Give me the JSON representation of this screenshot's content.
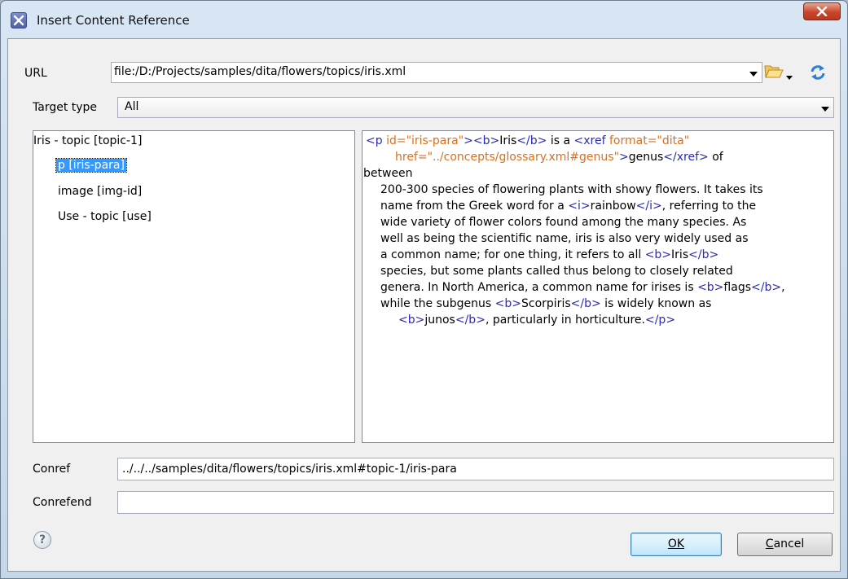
{
  "window": {
    "title": "Insert Content Reference"
  },
  "url": {
    "label": "URL",
    "value": "file:/D:/Projects/samples/dita/flowers/topics/iris.xml"
  },
  "target_type": {
    "label": "Target type",
    "value": "All"
  },
  "tree": {
    "items": [
      {
        "label": "Iris - topic [topic-1]"
      },
      {
        "label": "p [iris-para]"
      },
      {
        "label": "image [img-id]"
      },
      {
        "label": "Use - topic [use]"
      }
    ]
  },
  "preview": {
    "line1": {
      "t1": "<p ",
      "a1": "id=\"iris-para\"",
      "t2": "><b>",
      "x1": "Iris",
      "t3": "</b>",
      "x2": " is a ",
      "t4": "<xref ",
      "a2": "format=\"dita\""
    },
    "line2": {
      "a1": "href=\"../concepts/glossary.xml#genus\"",
      "t1": ">",
      "x1": "genus",
      "t2": "</xref>",
      "x2": " of"
    },
    "line3": "between",
    "line4": "200-300 species of flowering plants with showy flowers. It takes its",
    "line5": {
      "x1": "name from the Greek    word for a ",
      "t1": "<i>",
      "x2": "rainbow",
      "t2": "</i>",
      "x3": ", referring to the"
    },
    "line6": "wide variety of flower colors found among the many    species. As",
    "line7": "well as being the scientific name, iris is also very widely used as",
    "line8": {
      "x1": "a common name;    for one thing, it refers to all ",
      "t1": "<b>",
      "x2": "Iris",
      "t2": "</b>"
    },
    "line9": "species, but some plants called thus belong to    closely related",
    "line10": {
      "x1": "genera. In North America, a common name for irises is ",
      "t1": "<b>",
      "x2": "flags",
      "t2": "</b>",
      "x3": ","
    },
    "line11": {
      "x1": "while the    subgenus ",
      "t1": "<b>",
      "x2": "Scorpiris",
      "t2": "</b>",
      "x3": " is widely known as"
    },
    "line12": {
      "t1": "<b>",
      "x1": "junos",
      "t2": "</b>",
      "x2": ", particularly in horticulture.",
      "t3": "</p>"
    }
  },
  "conref": {
    "label": "Conref",
    "value": "../../../samples/dita/flowers/topics/iris.xml#topic-1/iris-para"
  },
  "conrefend": {
    "label": "Conrefend",
    "value": ""
  },
  "buttons": {
    "ok": "OK",
    "cancel_underlined": "C",
    "cancel_rest": "ancel"
  },
  "colors": {
    "tag": "#2a2ab8",
    "attribute": "#d96f21",
    "selection": "#3399ff"
  },
  "icons": {
    "browse": "folder-open-icon",
    "dropdown": "chevron-down-icon",
    "reload": "reload-icon",
    "help": "help-icon",
    "close": "close-icon"
  }
}
